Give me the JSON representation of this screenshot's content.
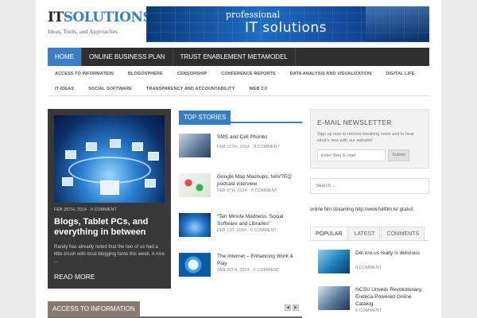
{
  "logo": {
    "title_it": "IT",
    "title_sol": "SOLUTIONS",
    "tagline": "Ideas, Tools, and Approaches"
  },
  "banner": {
    "line1": "professional",
    "line2": "IT solutions"
  },
  "nav": {
    "items": [
      {
        "label": "HOME",
        "active": true
      },
      {
        "label": "ONLINE BUSINESS PLAN",
        "active": false
      },
      {
        "label": "TRUST ENABLEMENT METAMODEL",
        "active": false
      }
    ]
  },
  "subnav": {
    "row1": [
      "ACCESS TO INFORMATION",
      "BLOGOSPHERE",
      "CENSORSHIP",
      "CONFERENCE REPORTS",
      "DATA ANALYSIS AND VISUALIZATION",
      "DIGITAL LIFE"
    ],
    "row2": [
      "IT-IDEAS",
      "SOCIAL SOFTWARE",
      "TRANSPARENCY AND ACCOUNTABILITY",
      "WEB 2.0"
    ]
  },
  "feature": {
    "date": "FEB 25TH, 2014 · 0 COMMENT",
    "title": "Blogs, Tablet PCs, and everything in between",
    "excerpt": "Randy has already noted that the two of us had a little brush with local blogging fame this week. A nice ...",
    "more": "READ MORE"
  },
  "top_stories": {
    "label": "TOP STORIES",
    "items": [
      {
        "title": "SMS and Cell Phones",
        "date": "FEB 10TH, 2014 · 0 COMMENT"
      },
      {
        "title": "Google Map Mashups; NAVTEQ podcast interview",
        "date": "FEB 6TH, 2014 · 0 COMMENT"
      },
      {
        "title": "“Ten Minute Madness: Social Software and Libraries”",
        "date": "FEB 1ST, 2014 · 0 COMMENT"
      },
      {
        "title": "The Internet – Enhancing Work & Play",
        "date": "JAN 30TH, 2014 · 0 COMMENT"
      }
    ]
  },
  "access_bar": {
    "label": "ACCESS TO INFORMATION",
    "prev": "◀",
    "next": "▶"
  },
  "newsletter": {
    "title": "E-MAIL NEWSLETTER",
    "text": "Sign up now to receive breaking news and to hear what's new with our website!",
    "placeholder": "Enter Your E-mail",
    "submit": "Submit"
  },
  "search": {
    "placeholder": "Search ..."
  },
  "stream_text": "online film streaming http://www.fullfilm.tv/ gratuit.",
  "sidebar_tabs": [
    {
      "label": "POPULAR",
      "active": true
    },
    {
      "label": "LATEST",
      "active": false
    },
    {
      "label": "COMMENTS",
      "active": false
    }
  ],
  "popular": [
    {
      "title": "Del.icio.us really is delicious",
      "meta": "0 COMMENT"
    },
    {
      "title": "NCSU Unveils Revolutionary, Endeca-Powered Online Catalog",
      "meta": "0 COMMENT"
    }
  ]
}
